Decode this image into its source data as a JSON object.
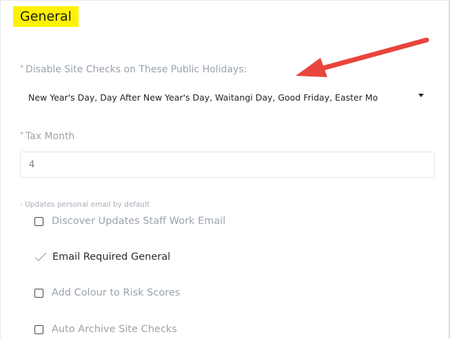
{
  "section": {
    "title": "General"
  },
  "holidays": {
    "required_mark": "*",
    "label": "Disable Site Checks on These Public Holidays:",
    "selected_value": "New Year's Day, Day After New Year's Day, Waitangi Day, Good Friday, Easter Mo"
  },
  "tax_month": {
    "required_mark": "*",
    "label": "Tax Month",
    "value": "4"
  },
  "hint": "- Updates personal email by default",
  "checkboxes": [
    {
      "label": "Discover Updates Staff Work Email",
      "checked": false
    },
    {
      "label": "Email Required General",
      "checked": true
    },
    {
      "label": "Add Colour to Risk Scores",
      "checked": false
    },
    {
      "label": "Auto Archive Site Checks",
      "checked": false
    }
  ],
  "colors": {
    "highlight": "#fff200",
    "arrow": "#e8453c",
    "label_gray": "#9aa3ac"
  }
}
